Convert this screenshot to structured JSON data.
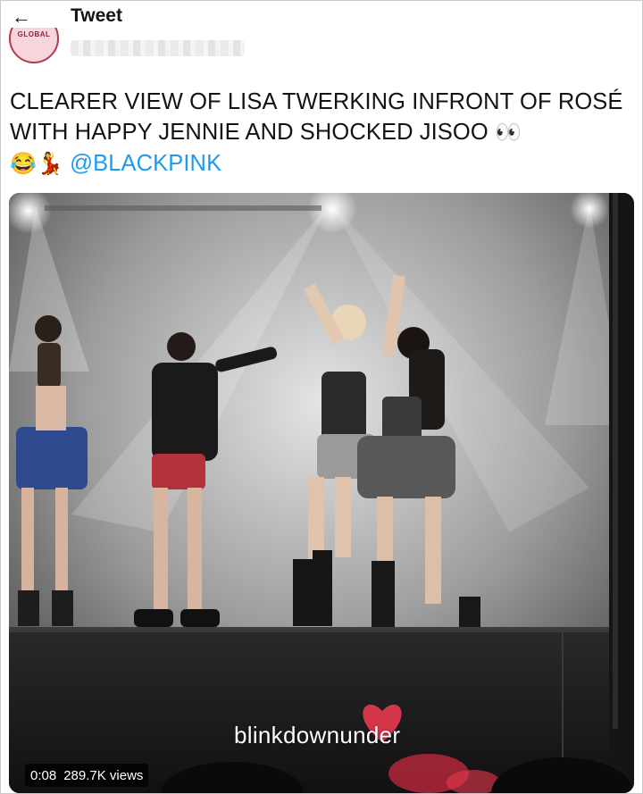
{
  "header": {
    "back_icon": "arrow-left-icon",
    "title": "Tweet"
  },
  "author": {
    "avatar_text": "GLOBAL",
    "name_blurred": true
  },
  "tweet": {
    "text": "CLEARER VIEW OF LISA TWERKING INFRONT OF ROSÉ WITH HAPPY JENNIE AND SHOCKED JISOO ",
    "emoji_eyes": "👀",
    "emoji_laugh": "😂",
    "emoji_dancer": "💃",
    "mention": "@BLACKPINK"
  },
  "media": {
    "watermark": "blinkdownunder",
    "duration": "0:08",
    "views": "289.7K views"
  },
  "colors": {
    "mention": "#1d9bf0",
    "text": "#0f1419"
  }
}
